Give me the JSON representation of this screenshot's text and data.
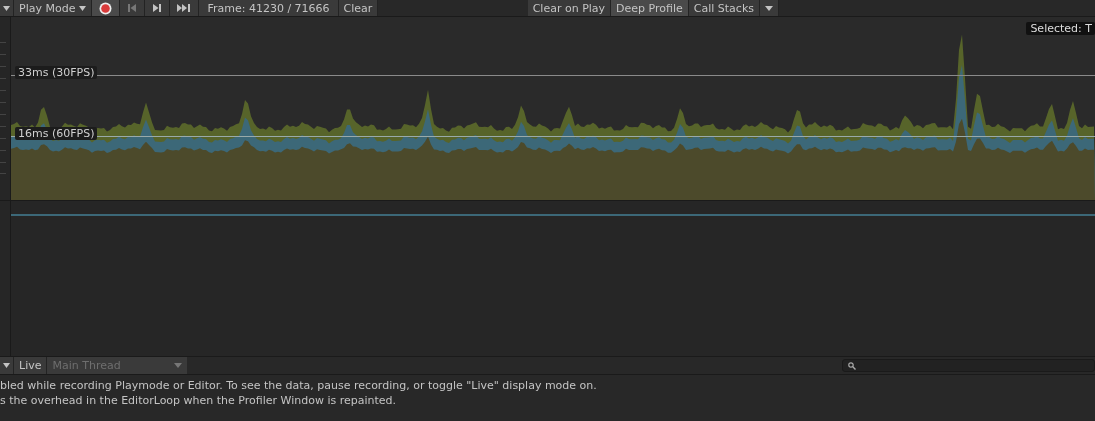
{
  "toolbar": {
    "mode": "Play Mode",
    "record": {
      "on": true
    },
    "frame": "Frame: 41230 / 71666",
    "clear": "Clear",
    "toggles": [
      {
        "label": "Clear on Play",
        "on": false
      },
      {
        "label": "Deep Profile",
        "on": true
      },
      {
        "label": "Call Stacks",
        "on": false
      }
    ]
  },
  "chart": {
    "thresholds": [
      "33ms (30FPS)",
      "16ms (60FPS)"
    ],
    "selected_tag": "Selected: T"
  },
  "details_bar": {
    "live": {
      "label": "Live",
      "on": false
    },
    "thread": {
      "value": "Main Thread",
      "disabled": true
    }
  },
  "status_lines": [
    "bled while recording Playmode or Editor. To see the data, pause recording, or toggle \"Live\" display mode on.",
    "s the overhead in the EditorLoop when the Profiler Window is repainted."
  ]
}
